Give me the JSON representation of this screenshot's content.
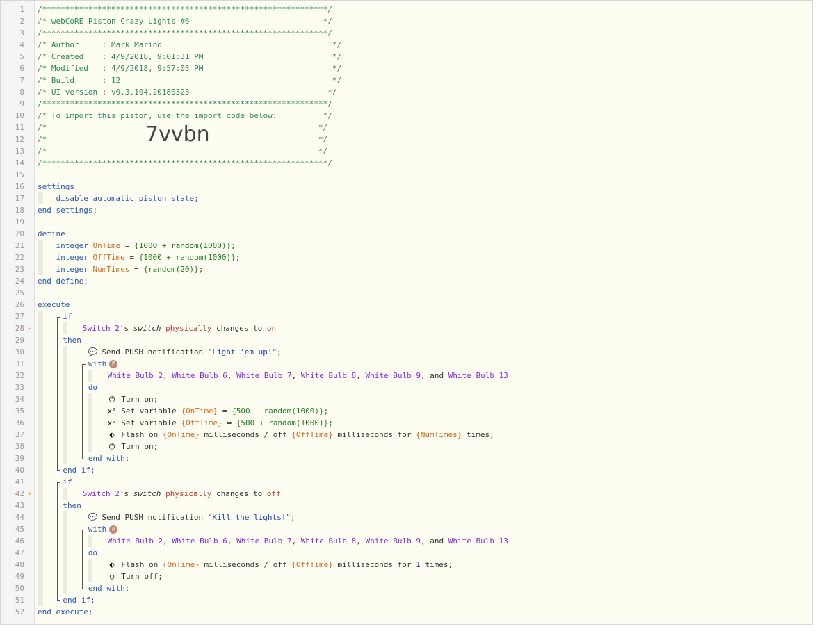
{
  "line_numbers": [
    "1",
    "2",
    "3",
    "4",
    "5",
    "6",
    "7",
    "8",
    "9",
    "10",
    "11",
    "12",
    "13",
    "14",
    "15",
    "16",
    "17",
    "18",
    "19",
    "20",
    "21",
    "22",
    "23",
    "24",
    "25",
    "26",
    "27",
    "28",
    "29",
    "30",
    "31",
    "32",
    "33",
    "34",
    "35",
    "36",
    "37",
    "38",
    "39",
    "40",
    "41",
    "42",
    "43",
    "44",
    "45",
    "46",
    "47",
    "48",
    "49",
    "50",
    "51",
    "52"
  ],
  "header": {
    "border": "/**************************************************************/",
    "title": "/* webCoRE Piston Crazy Lights #6                             */",
    "author": "/* Author     : Mark Marino                                     */",
    "created": "/* Created    : 4/9/2018, 9:01:31 PM                            */",
    "modified": "/* Modified   : 4/9/2018, 9:57:03 PM                            */",
    "build": "/* Build      : 12                                              */",
    "ui_version": "/* UI version : v0.3.104.20180323                              */",
    "import_note": "/* To import this piston, use the import code below:          */",
    "blank_left": "/*",
    "blank_right": "*/",
    "import_code": "7vvbn"
  },
  "settings": {
    "open": "settings",
    "item": "disable automatic piston state;",
    "close": "end settings;"
  },
  "define": {
    "open": "define",
    "type": "integer",
    "vars": [
      {
        "name": "OnTime",
        "eq": " = ",
        "expr": "{1000 + random(1000)}",
        "end": ";"
      },
      {
        "name": "OffTime",
        "eq": " = ",
        "expr": "{1000 + random(1000)}",
        "end": ";"
      },
      {
        "name": "NumTimes",
        "eq": " = ",
        "expr": "{random(20)}",
        "end": ";"
      }
    ],
    "close": "end define;"
  },
  "execute": {
    "open": "execute",
    "close": "end execute;",
    "if_kw": "if",
    "then_kw": "then",
    "endif_kw": "end if;",
    "with_kw": "with",
    "do_kw": "do",
    "endwith_kw": "end with;",
    "p_badge": "P",
    "trigger_device": "Switch 2",
    "trigger_poss": "'s ",
    "trigger_attr": "switch",
    "trigger_phys": "physically",
    "trigger_verb": " changes to ",
    "on_value": "on",
    "off_value": "off",
    "push_label": "Send PUSH notification ",
    "push1": "\"Light 'em up!\"",
    "push2": "\"Kill the lights!\"",
    "semi": ";",
    "devices": [
      "White Bulb 2",
      "White Bulb 6",
      "White Bulb 7",
      "White Bulb 8",
      "White Bulb 9"
    ],
    "devices_last": "White Bulb 13",
    "comma": ", ",
    "and": ", and ",
    "turn_on": "Turn on;",
    "turn_off": "Turn off;",
    "set_var": "Set variable ",
    "var_on": "{OnTime}",
    "var_off": "{OffTime}",
    "var_num": "{NumTimes}",
    "set_expr": "{500 + random(1000)}",
    "flash_on": "Flash on ",
    "ms_off": " milliseconds / off ",
    "ms_for": " milliseconds for ",
    "times": " times;",
    "one": "1"
  },
  "colors": {
    "comment": "#2e8b57",
    "keyword": "#2a59b0",
    "variable": "#d2691e",
    "device": "#8a2be2",
    "trigger_marker": "#f0a030",
    "background": "#fdfdf2"
  },
  "icons": {
    "trigger": "lightning-icon",
    "push": "speech-bubble-icon",
    "power": "power-icon",
    "variable": "x-squared-icon",
    "flash": "toggle-icon",
    "power_off": "circle-off-icon"
  }
}
